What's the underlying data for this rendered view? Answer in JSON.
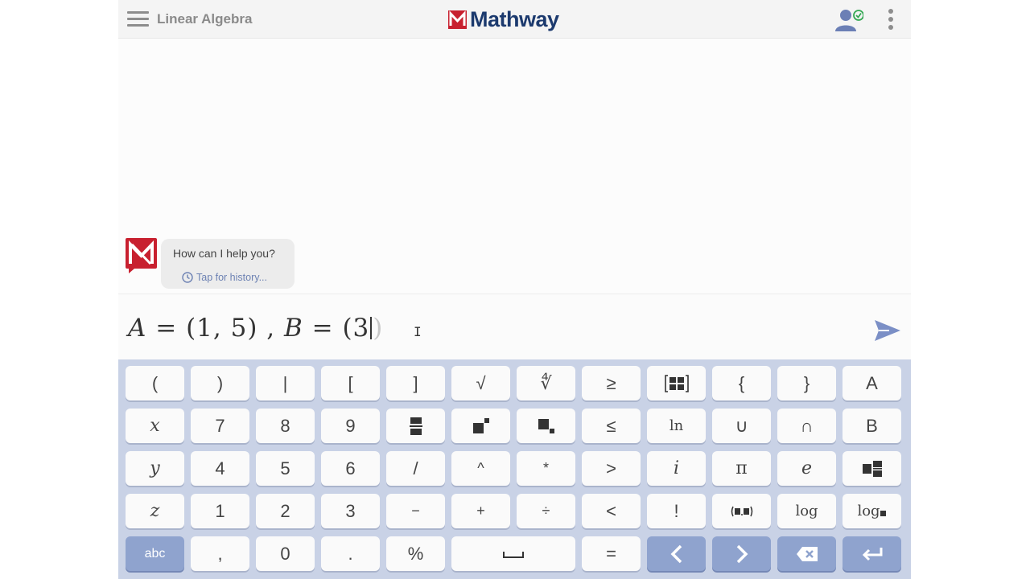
{
  "header": {
    "title": "Linear Algebra",
    "logo_text": "Mathway"
  },
  "chat": {
    "bubble_text": "How can I help you?",
    "history_link": "Tap for history..."
  },
  "input": {
    "expr_A": "A",
    "expr_eq1": " = (1, 5) , ",
    "expr_B": "B",
    "expr_eq2": " = (3",
    "expr_ghost": ")"
  },
  "keyboard": {
    "rows": [
      [
        "(",
        ")",
        "|",
        "[",
        "]",
        "√",
        "∜",
        "≥",
        "matrix",
        "{",
        "}",
        "A"
      ],
      [
        "x",
        "7",
        "8",
        "9",
        "fraction",
        "power",
        "subscript",
        "≤",
        "ln",
        "∪",
        "∩",
        "B"
      ],
      [
        "y",
        "4",
        "5",
        "6",
        "/",
        "^",
        "*",
        ">",
        "i",
        "π",
        "e",
        "mixed-fraction"
      ],
      [
        "z",
        "1",
        "2",
        "3",
        "−",
        "+",
        "÷",
        "<",
        "!",
        "vector",
        "log",
        "log-base"
      ],
      [
        "abc",
        ",",
        "0",
        ".",
        "%",
        "space",
        "=",
        "left",
        "right",
        "backspace",
        "enter"
      ]
    ],
    "labels": {
      "paren_open": "(",
      "paren_close": ")",
      "pipe": "|",
      "bracket_open": "[",
      "bracket_close": "]",
      "sqrt": "√",
      "nthroot": "∜",
      "geq": "≥",
      "brace_open": "{",
      "brace_close": "}",
      "A": "A",
      "x": "x",
      "seven": "7",
      "eight": "8",
      "nine": "9",
      "leq": "≤",
      "ln": "ln",
      "union": "∪",
      "intersect": "∩",
      "B": "B",
      "y": "y",
      "four": "4",
      "five": "5",
      "six": "6",
      "slash": "/",
      "caret": "^",
      "star": "*",
      "gt": ">",
      "i": "i",
      "pi": "π",
      "e": "e",
      "z": "z",
      "one": "1",
      "two": "2",
      "three": "3",
      "minus": "−",
      "plus": "+",
      "divide": "÷",
      "lt": "<",
      "factorial": "!",
      "log": "log",
      "logbase": "log",
      "abc": "abc",
      "comma": ",",
      "zero": "0",
      "dot": ".",
      "percent": "%",
      "equals": "="
    }
  },
  "colors": {
    "keyboard_bg": "#c9d2e6",
    "dark_key": "#8fa3ce",
    "brand_red": "#c8202f",
    "brand_blue": "#1c3a6e",
    "accent": "#6d82b3"
  }
}
